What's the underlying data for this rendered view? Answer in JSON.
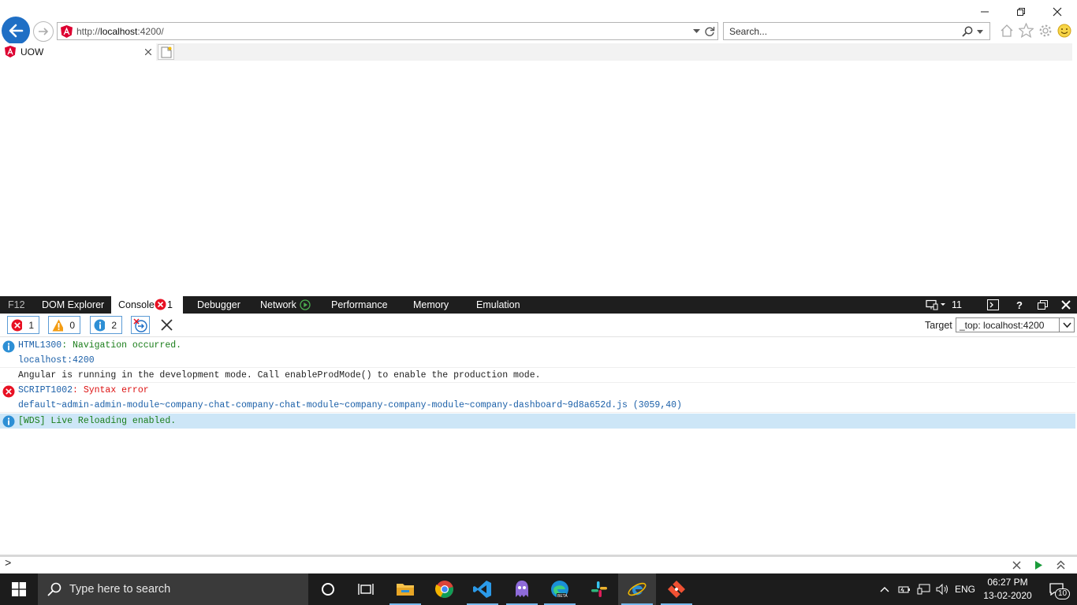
{
  "browser": {
    "address": {
      "prefix": "http://",
      "host": "localhost",
      "rest": ":4200/"
    },
    "search_placeholder": "Search...",
    "tab_title": "UOW",
    "icons": [
      "back-arrow-icon",
      "forward-arrow-icon",
      "angular-icon",
      "refresh-icon",
      "search-icon",
      "home-icon",
      "favorites-star-icon",
      "settings-gear-icon",
      "smiley-feedback-icon"
    ]
  },
  "devtools": {
    "tabs": [
      {
        "label": "F12"
      },
      {
        "label": "DOM Explorer"
      },
      {
        "label": "Console",
        "error_count": "1"
      },
      {
        "label": "Debugger"
      },
      {
        "label": "Network"
      },
      {
        "label": "Performance"
      },
      {
        "label": "Memory"
      },
      {
        "label": "Emulation"
      }
    ],
    "document_mode": "11",
    "filters": {
      "errors": "1",
      "warnings": "0",
      "info": "2"
    },
    "target_label": "Target",
    "target_value": "_top: localhost:4200",
    "messages": [
      {
        "type": "info",
        "code": "HTML1300",
        "text": ": Navigation occurred.",
        "source": "localhost:4200"
      },
      {
        "type": "log",
        "text": "Angular is running in the development mode. Call enableProdMode() to enable the production mode."
      },
      {
        "type": "error",
        "code": "SCRIPT1002",
        "text": ": Syntax error",
        "source": "default~admin-admin-module~company-chat-company-chat-module~company-company-module~company-dashboard~9d8a652d.js (3059,40)"
      },
      {
        "type": "info",
        "text": "[WDS] Live Reloading enabled.",
        "highlighted": true
      }
    ],
    "prompt_symbol": ">"
  },
  "taskbar": {
    "search_placeholder": "Type here to search",
    "apps": [
      "cortana",
      "task-view",
      "file-explorer",
      "chrome",
      "vscode",
      "ghost-app",
      "edge-beta",
      "slack",
      "internet-explorer",
      "git"
    ],
    "language": "ENG",
    "time": "06:27 PM",
    "date": "13-02-2020",
    "notifications": "10"
  },
  "colors": {
    "accent": "#1f6fc5",
    "devtools_bar": "#1e1e1e",
    "error": "#d11",
    "info": "#1a7d1a",
    "highlight": "#cde6f7"
  }
}
